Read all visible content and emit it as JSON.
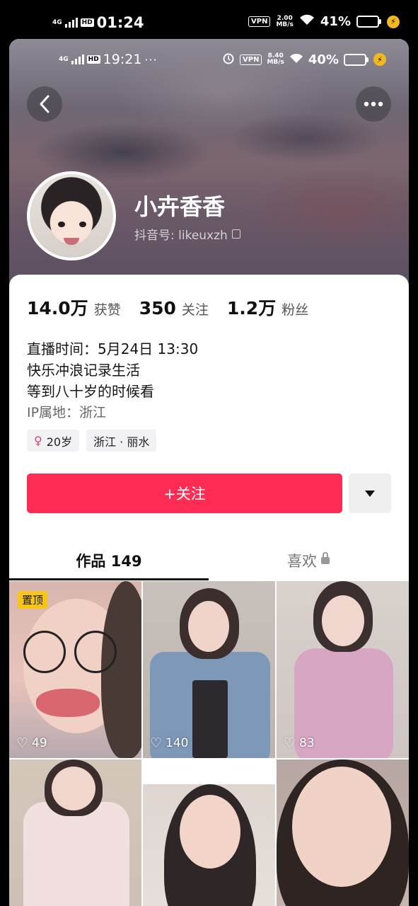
{
  "outer_status": {
    "network": "4G",
    "hd": "HD",
    "time": "01:24",
    "vpn": "VPN",
    "speed_num": "2.00",
    "speed_unit": "MB/s",
    "battery": "41%",
    "battery_level": 0.41
  },
  "inner_status": {
    "network": "4G",
    "hd": "HD",
    "time": "19:21",
    "dots": "···",
    "vpn": "VPN",
    "speed_num": "8.40",
    "speed_unit": "MB/s",
    "battery": "40%",
    "battery_level": 0.4
  },
  "profile": {
    "nickname": "小卉香香",
    "douyin_id": "抖音号: likeuxzh",
    "stats": [
      {
        "num": "14.0万",
        "label": "获赞"
      },
      {
        "num": "350",
        "label": "关注"
      },
      {
        "num": "1.2万",
        "label": "粉丝"
      }
    ],
    "bio_lines": [
      "直播时间：5月24日 13:30",
      "快乐冲浪记录生活",
      "等到八十岁的时候看"
    ],
    "ip": "IP属地：浙江",
    "tags": {
      "age": "20岁",
      "region": "浙江 · 丽水"
    },
    "gender_icon": "female-icon"
  },
  "actions": {
    "follow": "+关注"
  },
  "tabs": {
    "works": "作品 149",
    "likes": "喜欢"
  },
  "videos": [
    {
      "badge": "置顶",
      "likes": "49"
    },
    {
      "likes": "140"
    },
    {
      "likes": "83"
    },
    {
      "likes": ""
    },
    {
      "likes": ""
    },
    {
      "likes": ""
    }
  ],
  "colors": {
    "accent": "#fe2c55",
    "pin_badge": "#f5c518"
  }
}
